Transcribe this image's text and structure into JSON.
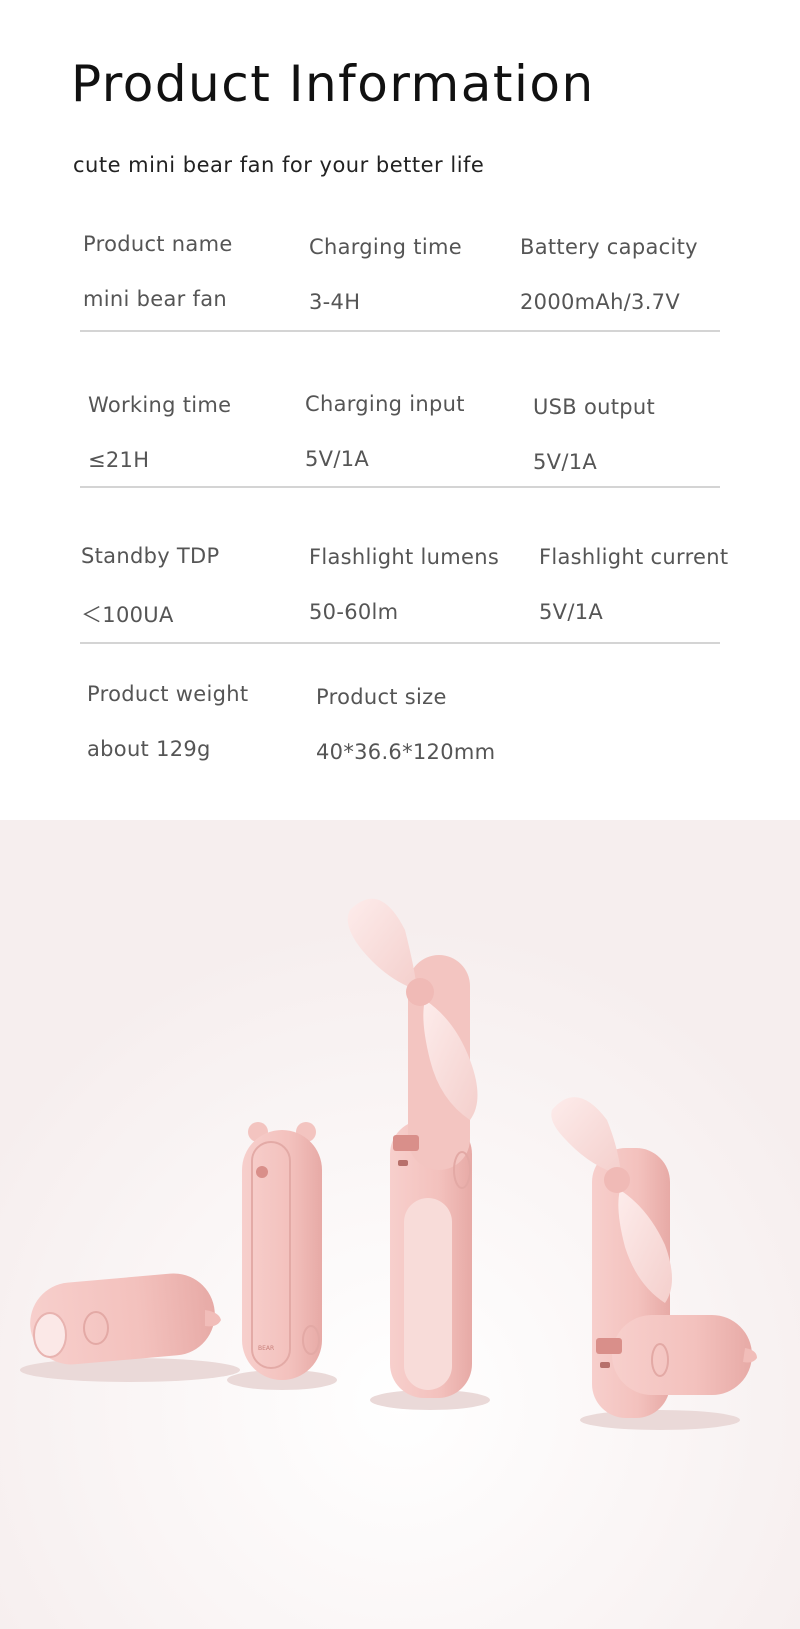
{
  "title": "Product Information",
  "subtitle": "cute mini bear fan for your better life",
  "specs": [
    {
      "label": "Product name",
      "value": "mini bear fan"
    },
    {
      "label": "Charging time",
      "value": "3-4H"
    },
    {
      "label": "Battery capacity",
      "value": "2000mAh/3.7V"
    },
    {
      "label": "Working time",
      "value": "≤21H"
    },
    {
      "label": "Charging input",
      "value": "5V/1A"
    },
    {
      "label": "USB output",
      "value": "5V/1A"
    },
    {
      "label": "Standby TDP",
      "value": "＜100UA"
    },
    {
      "label": "Flashlight lumens",
      "value": "50-60lm"
    },
    {
      "label": "Flashlight current",
      "value": "5V/1A"
    },
    {
      "label": "Product weight",
      "value": "about 129g"
    },
    {
      "label": "Product size",
      "value": "40*36.6*120mm"
    }
  ],
  "product_badge": "BEAR",
  "colors": {
    "fan_pink": "#f5c9c6",
    "fan_pink_dark": "#e9aba8",
    "blade": "#fbe3e0"
  }
}
